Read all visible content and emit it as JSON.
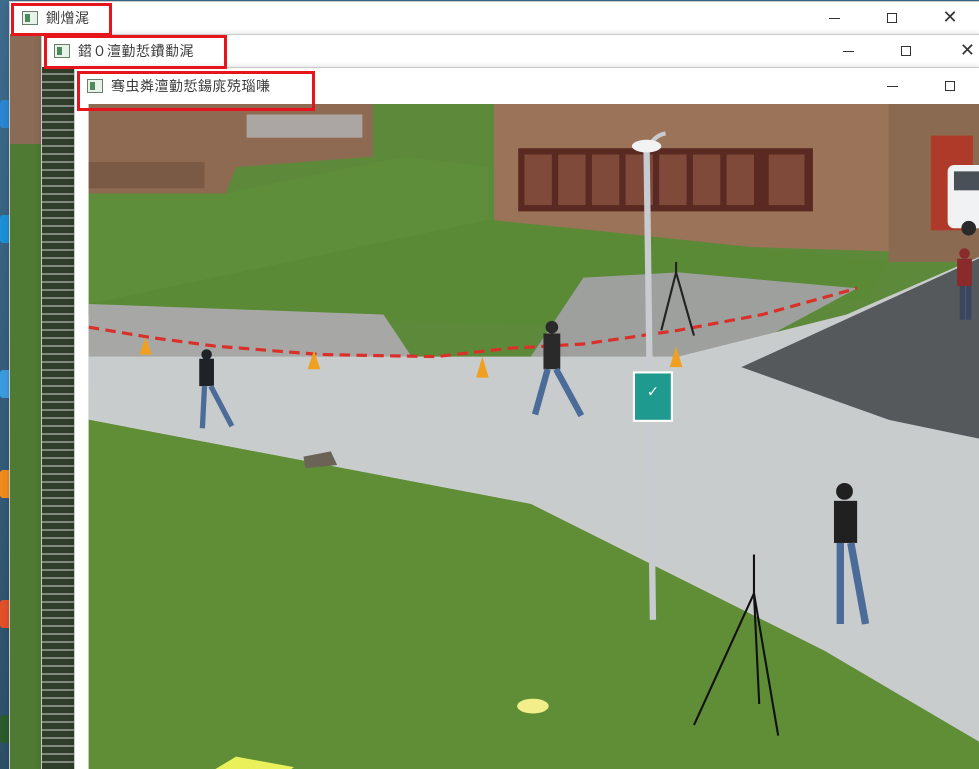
{
  "windows": [
    {
      "title": "鍘熷浘",
      "controls": [
        "minimize",
        "maximize",
        "close"
      ]
    },
    {
      "title": "鍣０澶勭悊鐨勫浘",
      "controls": [
        "minimize",
        "maximize",
        "close"
      ]
    },
    {
      "title": "骞虫粦澶勭悊鍚庣殑瑙嗛",
      "controls": [
        "minimize",
        "maximize"
      ]
    }
  ],
  "scene": {
    "sign_text": "✓",
    "colors": {
      "grass": "#5d8a3a",
      "road": "#cfd2d4",
      "brick": "#8e6a52",
      "tape": "#d9302a",
      "cone": "#f0a020",
      "highlight": "#e8141b"
    }
  }
}
